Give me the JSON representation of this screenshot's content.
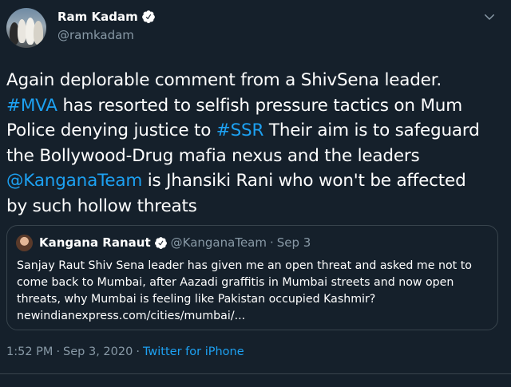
{
  "author": {
    "name": "Ram Kadam",
    "handle": "@ramkadam"
  },
  "tweet_lines": [
    [
      {
        "t": "Again deplorable comment from a ShivSena leader.",
        "link": false
      }
    ],
    [
      {
        "t": "#MVA",
        "link": true
      },
      {
        "t": " has resorted to selfish pressure tactics on Mum",
        "link": false
      }
    ],
    [
      {
        "t": "Police denying justice to ",
        "link": false
      },
      {
        "t": "#SSR",
        "link": true
      },
      {
        "t": " Their aim is to safeguard",
        "link": false
      }
    ],
    [
      {
        "t": "the Bollywood-Drug mafia nexus and the leaders",
        "link": false
      }
    ],
    [
      {
        "t": "@KanganaTeam",
        "link": true
      },
      {
        "t": " is Jhansiki Rani who won't be affected",
        "link": false
      }
    ],
    [
      {
        "t": "by such hollow threats",
        "link": false
      }
    ]
  ],
  "quoted": {
    "name": "Kangana Ranaut",
    "handle": "@KanganaTeam",
    "dot": "·",
    "date": "Sep 3",
    "lines": [
      "Sanjay Raut Shiv Sena leader has given me an open threat and asked me not to",
      "come back to Mumbai, after Aazadi graffitis in Mumbai streets and now open",
      "threats, why Mumbai is feeling like Pakistan occupied Kashmir?",
      "newindianexpress.com/cities/mumbai/..."
    ]
  },
  "meta": {
    "time": "1:52 PM",
    "sep1": "·",
    "date": "Sep 3, 2020",
    "sep2": "·",
    "source": "Twitter for iPhone"
  },
  "colors": {
    "background": "#15202b",
    "link": "#1da1f2",
    "muted": "#8899a6",
    "border": "#38444d"
  },
  "icons": {
    "verified": "verified-badge-icon",
    "menu": "chevron-down-icon"
  }
}
